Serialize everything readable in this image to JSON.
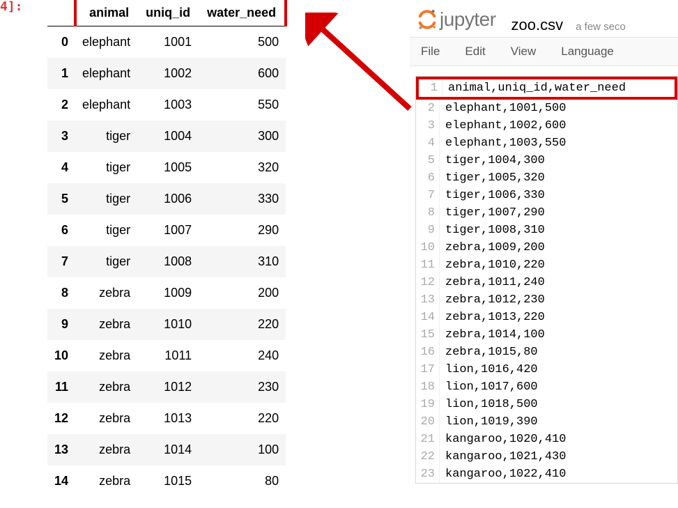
{
  "prompt": "4]:",
  "table": {
    "columns": [
      "animal",
      "uniq_id",
      "water_need"
    ],
    "rows": [
      {
        "idx": "0",
        "animal": "elephant",
        "uniq_id": "1001",
        "water_need": "500"
      },
      {
        "idx": "1",
        "animal": "elephant",
        "uniq_id": "1002",
        "water_need": "600"
      },
      {
        "idx": "2",
        "animal": "elephant",
        "uniq_id": "1003",
        "water_need": "550"
      },
      {
        "idx": "3",
        "animal": "tiger",
        "uniq_id": "1004",
        "water_need": "300"
      },
      {
        "idx": "4",
        "animal": "tiger",
        "uniq_id": "1005",
        "water_need": "320"
      },
      {
        "idx": "5",
        "animal": "tiger",
        "uniq_id": "1006",
        "water_need": "330"
      },
      {
        "idx": "6",
        "animal": "tiger",
        "uniq_id": "1007",
        "water_need": "290"
      },
      {
        "idx": "7",
        "animal": "tiger",
        "uniq_id": "1008",
        "water_need": "310"
      },
      {
        "idx": "8",
        "animal": "zebra",
        "uniq_id": "1009",
        "water_need": "200"
      },
      {
        "idx": "9",
        "animal": "zebra",
        "uniq_id": "1010",
        "water_need": "220"
      },
      {
        "idx": "10",
        "animal": "zebra",
        "uniq_id": "1011",
        "water_need": "240"
      },
      {
        "idx": "11",
        "animal": "zebra",
        "uniq_id": "1012",
        "water_need": "230"
      },
      {
        "idx": "12",
        "animal": "zebra",
        "uniq_id": "1013",
        "water_need": "220"
      },
      {
        "idx": "13",
        "animal": "zebra",
        "uniq_id": "1014",
        "water_need": "100"
      },
      {
        "idx": "14",
        "animal": "zebra",
        "uniq_id": "1015",
        "water_need": "80"
      }
    ]
  },
  "jupyter": {
    "logo_text": "jupyter",
    "filename": "zoo.csv",
    "time": "a few seco",
    "menus": [
      "File",
      "Edit",
      "View",
      "Language"
    ]
  },
  "csv_lines": [
    {
      "n": "1",
      "text": "animal,uniq_id,water_need"
    },
    {
      "n": "2",
      "text": "elephant,1001,500"
    },
    {
      "n": "3",
      "text": "elephant,1002,600"
    },
    {
      "n": "4",
      "text": "elephant,1003,550"
    },
    {
      "n": "5",
      "text": "tiger,1004,300"
    },
    {
      "n": "6",
      "text": "tiger,1005,320"
    },
    {
      "n": "7",
      "text": "tiger,1006,330"
    },
    {
      "n": "8",
      "text": "tiger,1007,290"
    },
    {
      "n": "9",
      "text": "tiger,1008,310"
    },
    {
      "n": "10",
      "text": "zebra,1009,200"
    },
    {
      "n": "11",
      "text": "zebra,1010,220"
    },
    {
      "n": "12",
      "text": "zebra,1011,240"
    },
    {
      "n": "13",
      "text": "zebra,1012,230"
    },
    {
      "n": "14",
      "text": "zebra,1013,220"
    },
    {
      "n": "15",
      "text": "zebra,1014,100"
    },
    {
      "n": "16",
      "text": "zebra,1015,80"
    },
    {
      "n": "17",
      "text": "lion,1016,420"
    },
    {
      "n": "18",
      "text": "lion,1017,600"
    },
    {
      "n": "19",
      "text": "lion,1018,500"
    },
    {
      "n": "20",
      "text": "lion,1019,390"
    },
    {
      "n": "21",
      "text": "kangaroo,1020,410"
    },
    {
      "n": "22",
      "text": "kangaroo,1021,430"
    },
    {
      "n": "23",
      "text": "kangaroo,1022,410"
    }
  ]
}
